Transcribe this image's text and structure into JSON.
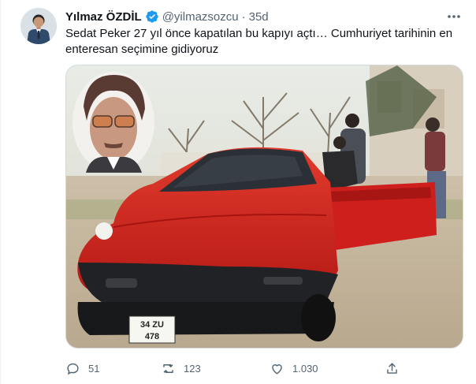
{
  "tweet": {
    "author_name": "Yılmaz ÖZDİL",
    "handle": "@yilmazsozcu",
    "separator": "·",
    "time": "35d",
    "text": "Sedat Peker 27 yıl önce kapatılan bu kapıyı açtı… Cumhuriyet tarihinin en enteresan seçimine gidiyoruz",
    "verified_color": "#1d9bf0",
    "accent_color": "#1d9bf0"
  },
  "media": {
    "plate_line1": "34 ZU",
    "plate_line2": "478",
    "car_color": "#d5201e"
  },
  "actions": {
    "reply_count": "51",
    "retweet_count": "123",
    "like_count": "1.030",
    "icons": [
      "reply-icon",
      "retweet-icon",
      "like-icon",
      "share-icon"
    ]
  }
}
